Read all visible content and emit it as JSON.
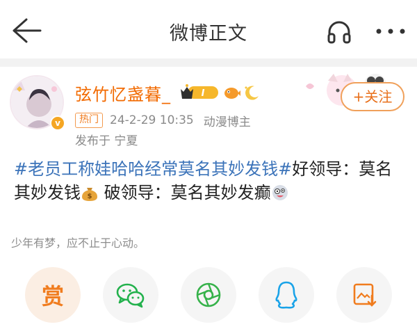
{
  "nav": {
    "title": "微博正文",
    "icons": [
      "back-arrow-icon",
      "headphone-icon",
      "more-dots-icon"
    ]
  },
  "post": {
    "username": "弦竹忆盏暮_",
    "level_badge": "I",
    "follow_label": "+关注",
    "hot_tag": "热门",
    "timestamp": "24-2-29 10:35",
    "role": "动漫博主",
    "location": "发布于 宁夏",
    "content": {
      "topic": "#老员工称娃哈哈经常莫名其妙发钱#",
      "text1": "好领导：莫名其妙发钱",
      "text2": " 破领导：莫名其妙发癫"
    },
    "signature": "少年有梦，应不止于心动。"
  },
  "share": {
    "reward_label": "赏",
    "items": [
      "reward-icon",
      "wechat-icon",
      "moments-icon",
      "qq-icon",
      "save-image-icon"
    ]
  },
  "colors": {
    "username": "#f26a00",
    "topic": "#3b73b9",
    "accent": "#f07c1e"
  }
}
